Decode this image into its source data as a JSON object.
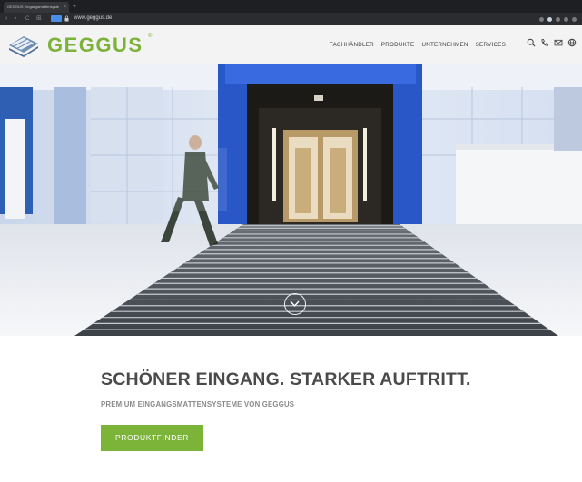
{
  "browser": {
    "tab_title": "GEGGUS Eingangsmattensyste",
    "tab_close": "×",
    "new_tab": "+",
    "url": "www.geggus.de",
    "nav_back": "‹",
    "nav_forward": "›",
    "nav_reload": "C",
    "nav_grid": "⊞"
  },
  "header": {
    "logo_text": "GEGGUS",
    "logo_reg": "®",
    "brand_color": "#7cb339",
    "nav": [
      "FACHHÄNDLER",
      "PRODUKTE",
      "UNTERNEHMEN",
      "SERVICES"
    ],
    "icons": [
      "search-icon",
      "phone-icon",
      "mail-icon",
      "globe-icon"
    ]
  },
  "hero": {
    "scroll_icon": "chevron-down-icon"
  },
  "content": {
    "headline": "SCHÖNER EINGANG. STARKER AUFTRITT.",
    "subline": "PREMIUM EINGANGSMATTENSYSTEME VON GEGGUS",
    "cta_label": "PRODUKTFINDER"
  }
}
